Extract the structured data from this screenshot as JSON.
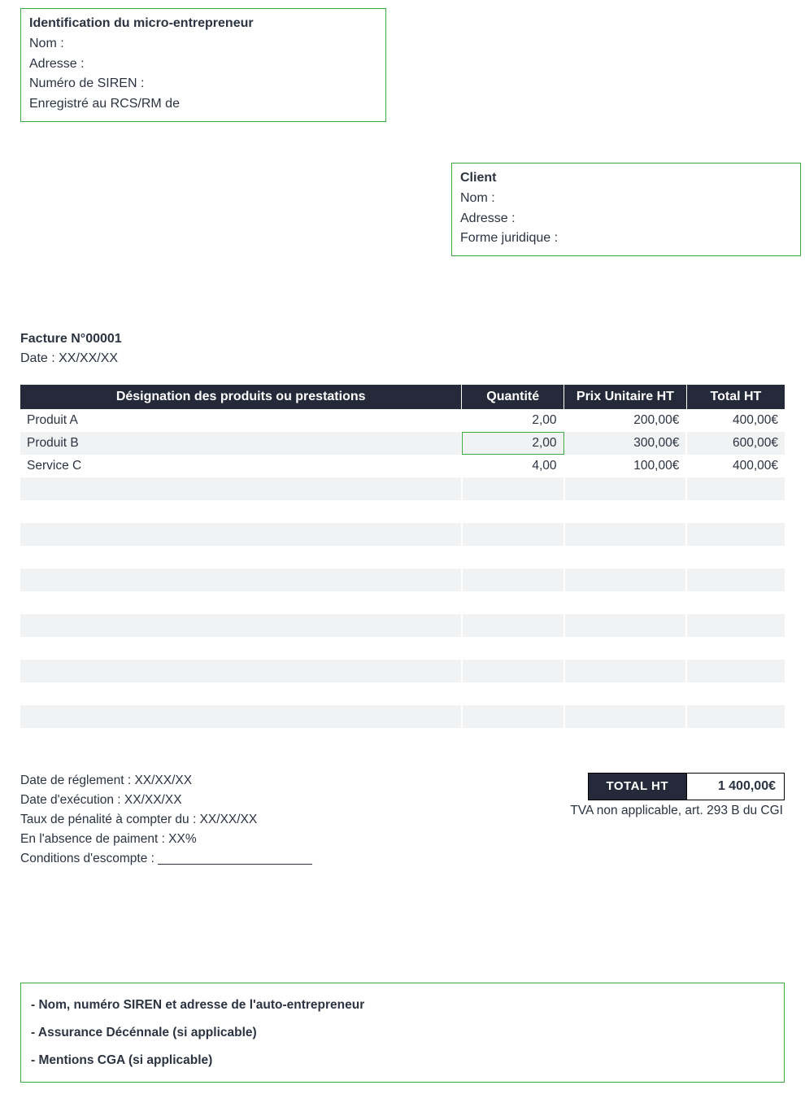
{
  "entrepreneur": {
    "title": "Identification du micro-entrepreneur",
    "name_label": "Nom :",
    "address_label": "Adresse :",
    "siren_label": "Numéro de SIREN :",
    "registered_label": "Enregistré au RCS/RM de"
  },
  "client": {
    "title": "Client",
    "name_label": "Nom :",
    "address_label": "Adresse :",
    "legal_form_label": "Forme juridique :"
  },
  "invoice": {
    "number_line": "Facture N°00001",
    "date_line": "Date : XX/XX/XX"
  },
  "columns": {
    "designation": "Désignation des produits ou prestations",
    "quantity": "Quantité",
    "unit_price": "Prix Unitaire HT",
    "total": "Total HT"
  },
  "lines": [
    {
      "designation": "Produit A",
      "quantity": "2,00",
      "unit_price": "200,00€",
      "total": "400,00€",
      "shade": false,
      "selected_qty": false
    },
    {
      "designation": "Produit B",
      "quantity": "2,00",
      "unit_price": "300,00€",
      "total": "600,00€",
      "shade": true,
      "selected_qty": true
    },
    {
      "designation": "Service C",
      "quantity": "4,00",
      "unit_price": "100,00€",
      "total": "400,00€",
      "shade": false,
      "selected_qty": false
    }
  ],
  "totals": {
    "label": "TOTAL HT",
    "value": "1 400,00€",
    "tva_note": "TVA non applicable, art. 293 B du CGI"
  },
  "terms": {
    "settlement_date": "Date de réglement : XX/XX/XX",
    "execution_date": "Date d'exécution : XX/XX/XX",
    "penalty_rate": "Taux de pénalité à compter du : XX/XX/XX",
    "no_payment": "En l'absence de paiment : XX%",
    "discount_conditions": "Conditions d'escompte : ______________________"
  },
  "footer": {
    "line1": "- Nom, numéro SIREN et adresse de l'auto-entrepreneur",
    "line2": "- Assurance Décénnale (si applicable)",
    "line3": "- Mentions CGA (si applicable)"
  }
}
